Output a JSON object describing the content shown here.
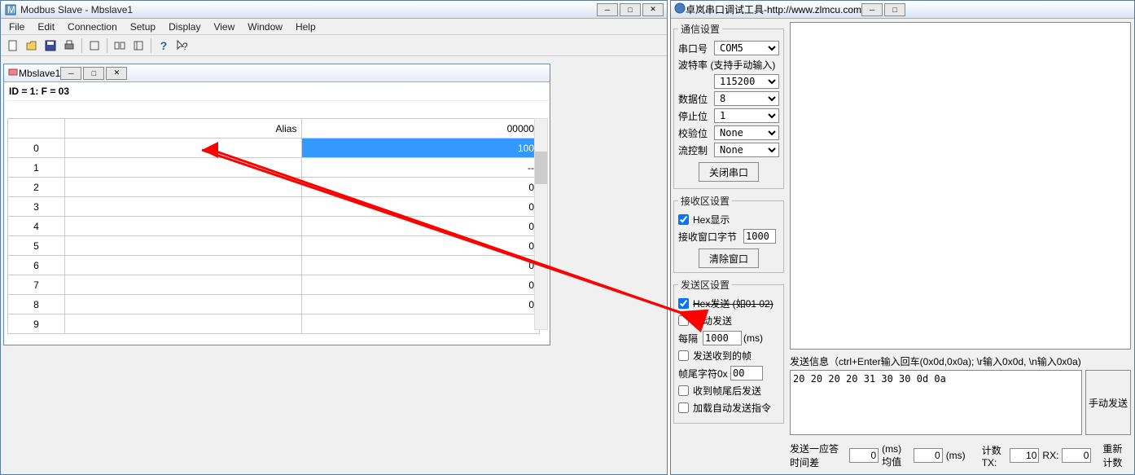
{
  "left": {
    "title": "Modbus Slave - Mbslave1",
    "menus": [
      "File",
      "Edit",
      "Connection",
      "Setup",
      "Display",
      "View",
      "Window",
      "Help"
    ],
    "inner": {
      "title": "Mbslave1",
      "info": "ID = 1: F = 03",
      "headers": {
        "alias": "Alias",
        "value": "00000"
      },
      "rows": [
        {
          "n": "0",
          "v": "100",
          "sel": true
        },
        {
          "n": "1",
          "v": "--"
        },
        {
          "n": "2",
          "v": "0"
        },
        {
          "n": "3",
          "v": "0"
        },
        {
          "n": "4",
          "v": "0"
        },
        {
          "n": "5",
          "v": "0"
        },
        {
          "n": "6",
          "v": "0"
        },
        {
          "n": "7",
          "v": "0"
        },
        {
          "n": "8",
          "v": "0"
        },
        {
          "n": "9",
          "v": ""
        }
      ]
    }
  },
  "right": {
    "title": "卓岚串口调试工具-http://www.zlmcu.com",
    "comm": {
      "legend": "通信设置",
      "port_label": "串口号",
      "port": "COM5",
      "baud_label": "波特率 (支持手动输入)",
      "baud": "115200",
      "databits_label": "数据位",
      "databits": "8",
      "stopbits_label": "停止位",
      "stopbits": "1",
      "parity_label": "校验位",
      "parity": "None",
      "flow_label": "流控制",
      "flow": "None",
      "close_btn": "关闭串口"
    },
    "recv": {
      "legend": "接收区设置",
      "hex_label": "Hex显示",
      "bytes_label": "接收窗口字节",
      "bytes": "1000",
      "clear_btn": "清除窗口"
    },
    "send": {
      "legend": "发送区设置",
      "hex_label": "Hex发送 (如01 02)",
      "auto_label": "自动发送",
      "interval_label": "每隔",
      "interval": "1000",
      "interval_unit": "(ms)",
      "recv_frame_label": "发送收到的帧",
      "tail_label": "帧尾字符0x",
      "tail": "00",
      "tail_send_label": "收到帧尾后发送",
      "load_label": "加载自动发送指令"
    },
    "sendbox": {
      "hint": "发送信息（ctrl+Enter输入回车(0x0d,0x0a); \\r输入0x0d, \\n输入0x0a)",
      "content": "20 20 20 20 31 30 30 0d 0a",
      "btn": "手动发送"
    },
    "status": {
      "resp_label": "发送一应答时间差",
      "resp": "0",
      "ms1": "(ms)均值",
      "avg": "0",
      "ms2": "(ms)",
      "tx_label": "计数TX:",
      "tx": "10",
      "rx_label": "RX:",
      "rx": "0",
      "reset": "重新计数"
    }
  }
}
